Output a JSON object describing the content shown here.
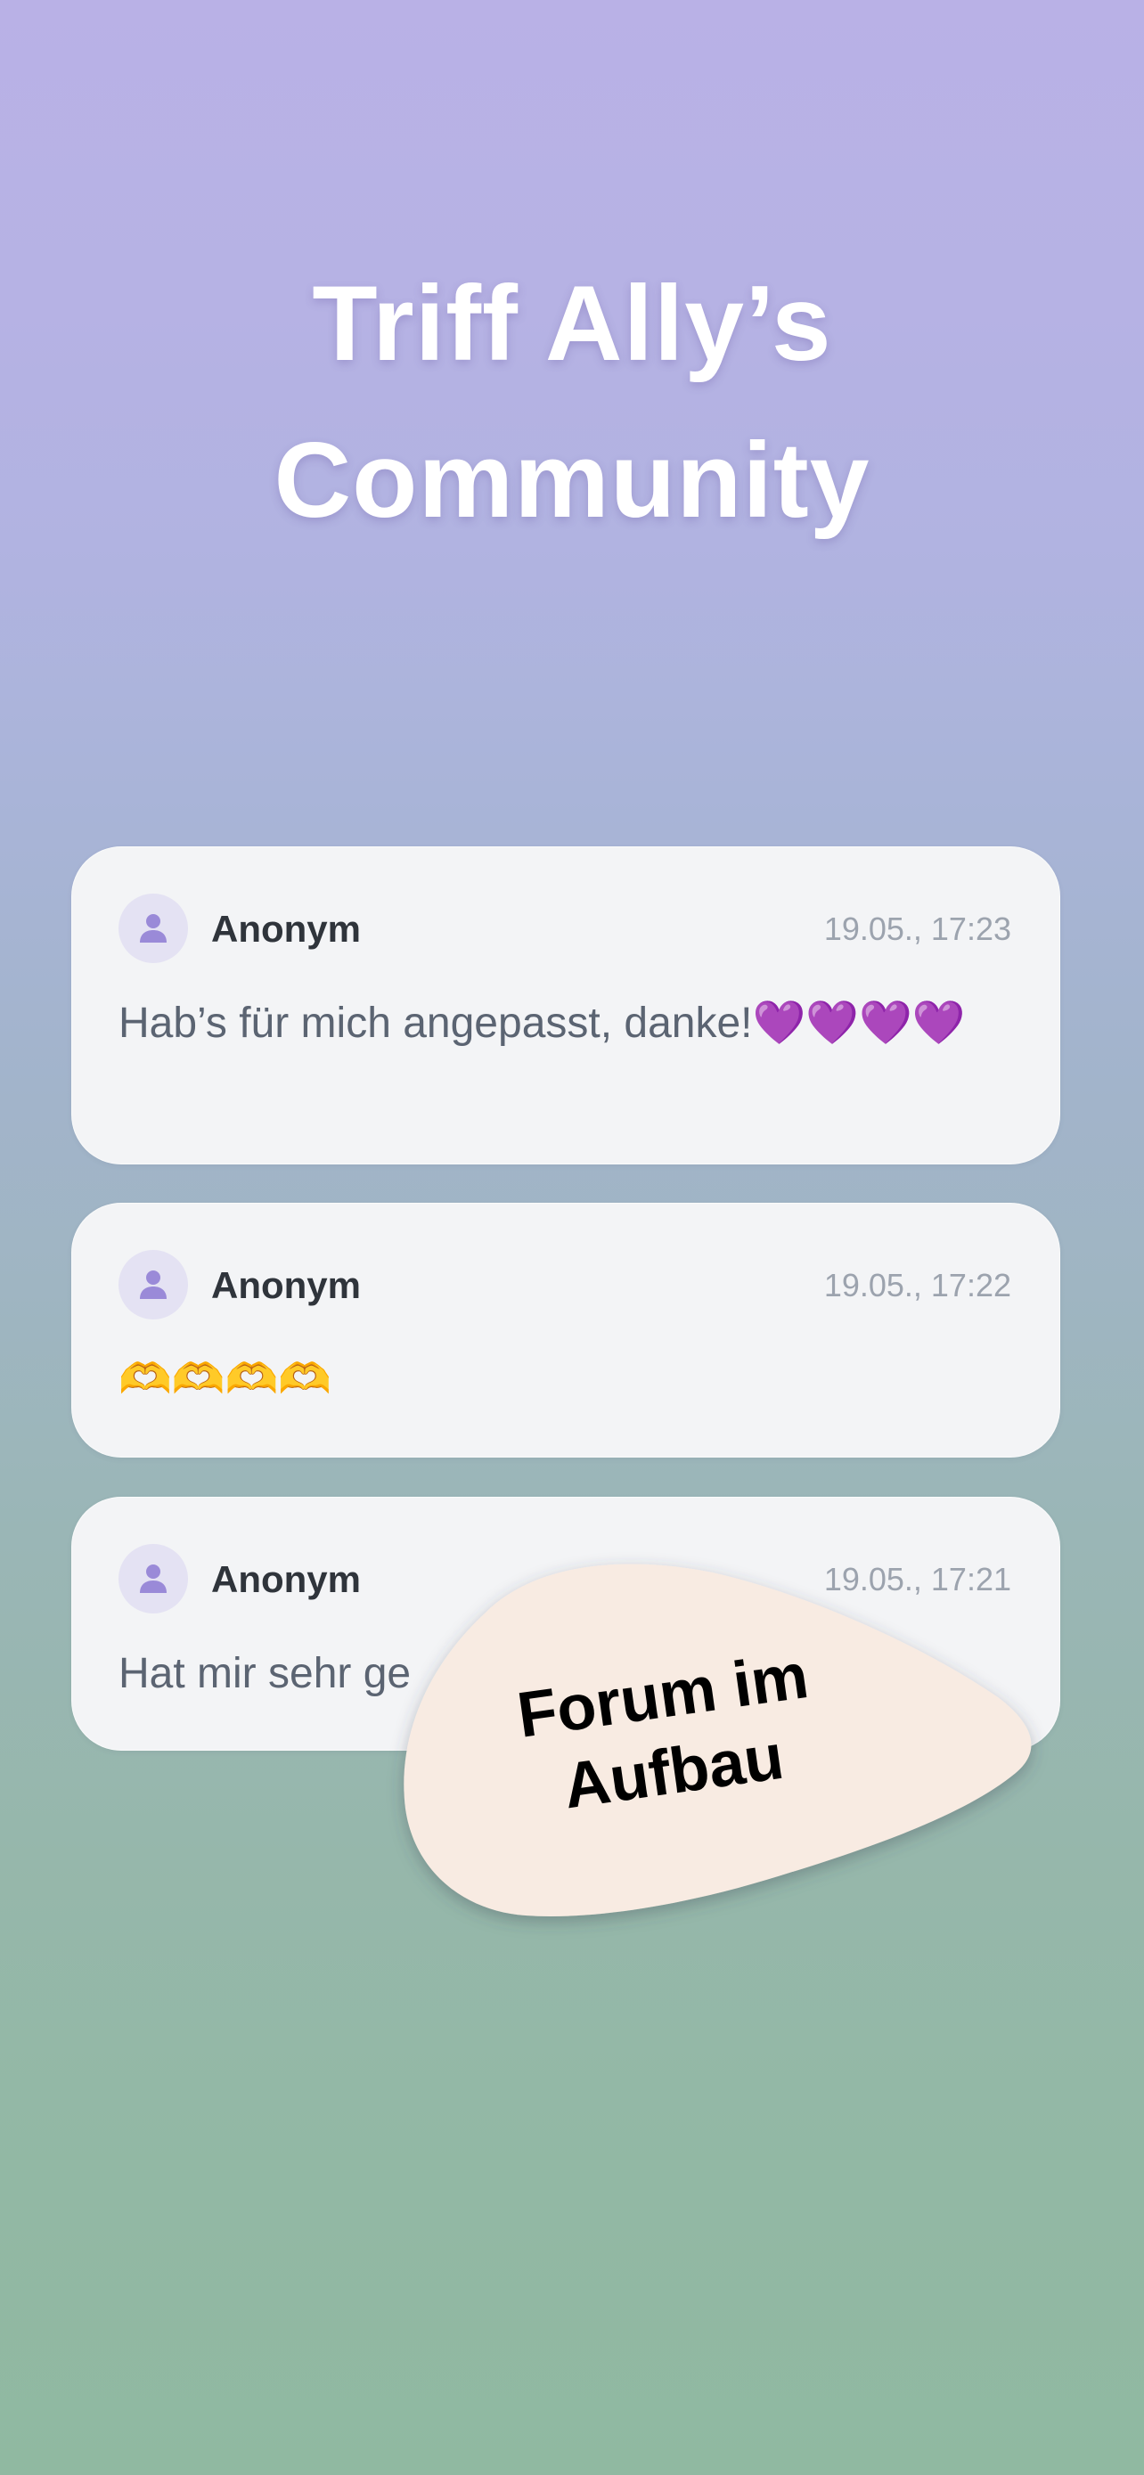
{
  "header": {
    "title_line_1": "Triff Ally’s",
    "title_line_2": "Community"
  },
  "posts": [
    {
      "author": "Anonym",
      "time": "19.05., 17:23",
      "text": "Hab’s für mich angepasst, danke!",
      "emoji": "💜💜💜💜"
    },
    {
      "author": "Anonym",
      "time": "19.05., 17:22",
      "text": "",
      "emoji": "🫶🫶🫶🫶"
    },
    {
      "author": "Anonym",
      "time": "19.05., 17:21",
      "text": "Hat mir sehr ge",
      "emoji": ""
    }
  ],
  "badge": {
    "line_1": "Forum im",
    "line_2": "Aufbau"
  },
  "icons": {
    "avatar": "person-icon"
  },
  "colors": {
    "accent": "#9a8ad8",
    "card_bg": "#f3f4f6",
    "badge_bg": "#f8ebe2"
  }
}
